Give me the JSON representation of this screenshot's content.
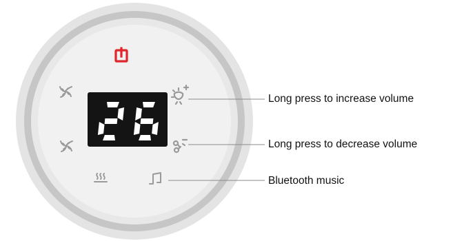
{
  "display": {
    "value": "26"
  },
  "callouts": {
    "increase_volume": "Long press to increase volume",
    "decrease_volume": "Long press to decrease volume",
    "bluetooth_music": "Bluetooth music"
  },
  "colors": {
    "outer_ring": "#c9c9c9",
    "face": "#efefef",
    "icon_gray": "#9a9a9a",
    "power_red": "#e0262a",
    "display_bg": "#141414",
    "digit": "#ffffff",
    "leader_line": "#8a8a8a"
  },
  "icons": {
    "power": "power-icon",
    "fan_top": "fan-icon",
    "fan_bottom": "fan-icon",
    "volume_up": "volume-up-icon",
    "volume_down": "volume-down-icon",
    "heat": "heat-icon",
    "music": "music-note-icon"
  }
}
